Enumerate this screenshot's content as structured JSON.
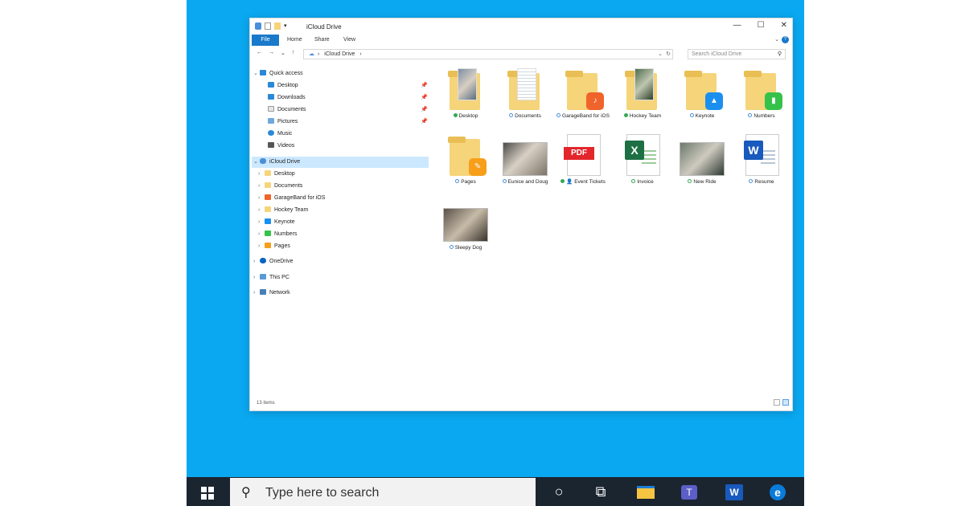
{
  "window": {
    "title": "iCloud Drive",
    "controls": {
      "minimize": "—",
      "maximize": "☐",
      "close": "✕"
    }
  },
  "ribbon": {
    "tabs": [
      "File",
      "Home",
      "Share",
      "View"
    ],
    "help": "?"
  },
  "navigation": {
    "back": "←",
    "forward": "→",
    "recent": "⌄",
    "up": "↑",
    "path": "iCloud Drive",
    "path_chevron": "›",
    "search_placeholder": "Search iCloud Drive"
  },
  "sidebar": {
    "quick_access": {
      "label": "Quick access",
      "items": [
        {
          "label": "Desktop",
          "icon": "desktop-icon",
          "pinned": true
        },
        {
          "label": "Downloads",
          "icon": "download-icon",
          "pinned": true
        },
        {
          "label": "Documents",
          "icon": "documents-icon",
          "pinned": true
        },
        {
          "label": "Pictures",
          "icon": "pictures-icon",
          "pinned": true
        },
        {
          "label": "Music",
          "icon": "music-icon",
          "pinned": false
        },
        {
          "label": "Videos",
          "icon": "videos-icon",
          "pinned": false
        }
      ]
    },
    "icloud": {
      "label": "iCloud Drive",
      "items": [
        {
          "label": "Desktop"
        },
        {
          "label": "Documents"
        },
        {
          "label": "GarageBand for iOS"
        },
        {
          "label": "Hockey Team"
        },
        {
          "label": "Keynote"
        },
        {
          "label": "Numbers"
        },
        {
          "label": "Pages"
        }
      ]
    },
    "onedrive": "OneDrive",
    "this_pc": "This PC",
    "network": "Network"
  },
  "files": [
    {
      "name": "Desktop",
      "kind": "folder-photo",
      "status": "ok"
    },
    {
      "name": "Documents",
      "kind": "folder-doc",
      "status": "cloud"
    },
    {
      "name": "GarageBand for iOS",
      "kind": "folder-app",
      "status": "cloud",
      "badge_color": "#f0632a"
    },
    {
      "name": "Hockey Team",
      "kind": "folder-photo",
      "status": "ok"
    },
    {
      "name": "Keynote",
      "kind": "folder-app",
      "status": "cloud",
      "badge_color": "#1b8ff0"
    },
    {
      "name": "Numbers",
      "kind": "folder-app",
      "status": "cloud",
      "badge_color": "#35c24a"
    },
    {
      "name": "Pages",
      "kind": "folder-app",
      "status": "cloud",
      "badge_color": "#f79f1a"
    },
    {
      "name": "Eunice and Doug",
      "kind": "photo",
      "status": "cloud"
    },
    {
      "name": "Event Tickets",
      "kind": "pdf",
      "status": "ok-shared"
    },
    {
      "name": "Invoice",
      "kind": "excel",
      "status": "okc"
    },
    {
      "name": "New Ride",
      "kind": "photo",
      "status": "okc"
    },
    {
      "name": "Resume",
      "kind": "word",
      "status": "cloud"
    },
    {
      "name": "Sleepy Dog",
      "kind": "photo",
      "status": "cloud"
    }
  ],
  "status": {
    "item_count": "13 items"
  },
  "taskbar": {
    "search_placeholder": "Type here to search",
    "icons": [
      "cortana-icon",
      "task-view-icon",
      "file-explorer-icon",
      "teams-icon",
      "word-icon",
      "edge-icon"
    ]
  }
}
